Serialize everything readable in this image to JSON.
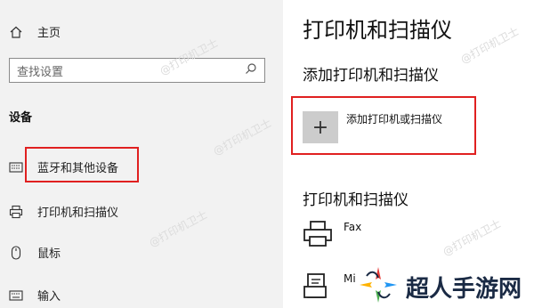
{
  "sidebar": {
    "home_label": "主页",
    "search_placeholder": "查找设置",
    "section_label": "设备",
    "items": [
      {
        "label": "蓝牙和其他设备",
        "icon": "keyboard-device-icon"
      },
      {
        "label": "打印机和扫描仪",
        "icon": "printer-icon"
      },
      {
        "label": "鼠标",
        "icon": "mouse-icon"
      },
      {
        "label": "输入",
        "icon": "keyboard-icon"
      }
    ]
  },
  "main": {
    "title": "打印机和扫描仪",
    "add_section_title": "添加打印机和扫描仪",
    "add_button_label": "添加打印机或扫描仪",
    "list_section_title": "打印机和扫描仪",
    "printers": [
      {
        "name": "Fax",
        "icon": "fax-icon"
      },
      {
        "name": "Mi",
        "icon": "printer-document-icon"
      }
    ]
  },
  "watermarks": [
    "@打印机卫士",
    "@打印机卫士",
    "@打印机卫士",
    "@打印机卫士",
    "@打印机卫士"
  ],
  "logo": {
    "text": "超人手游网"
  },
  "colors": {
    "highlight_border": "#e02020",
    "sidebar_bg": "#f2f2f2",
    "add_tile_bg": "#cccccc"
  }
}
